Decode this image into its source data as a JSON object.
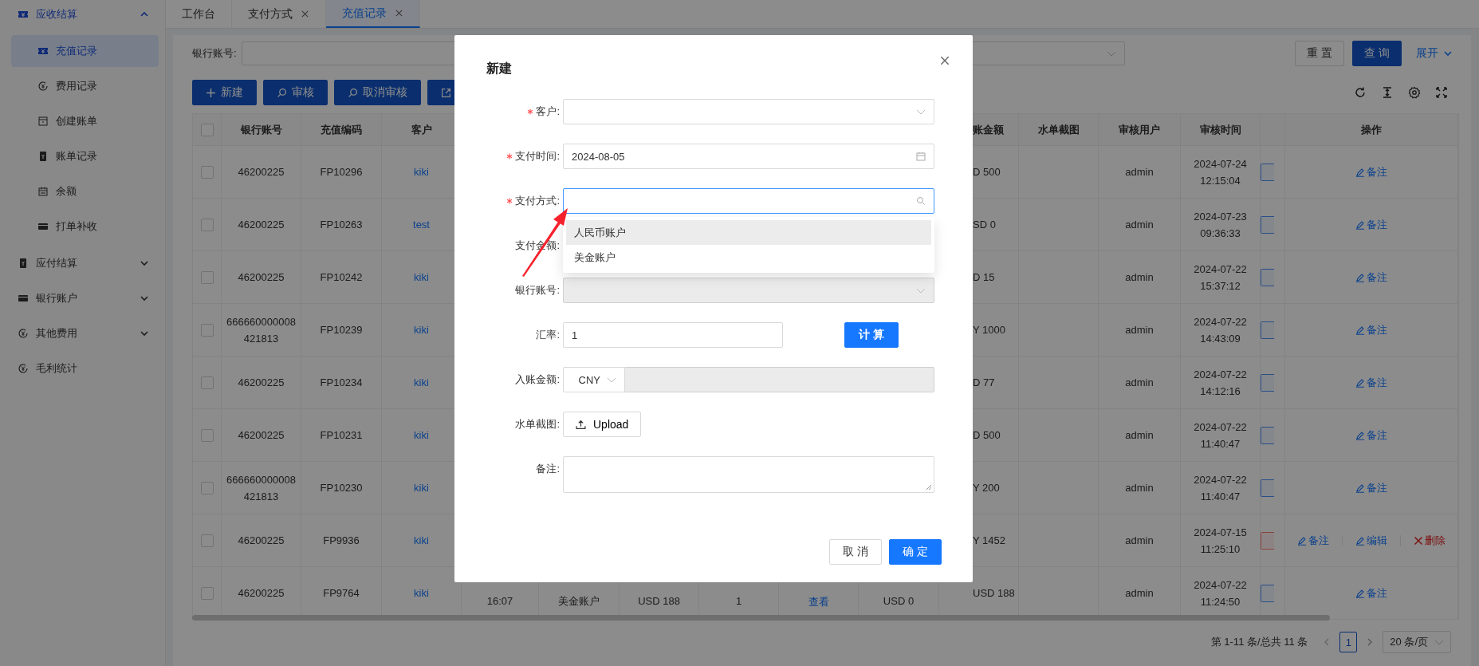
{
  "sidebar": {
    "items": [
      {
        "kind": "group",
        "label": "应收结算",
        "expanded": true,
        "children": [
          {
            "label": "充值记录",
            "selected": true
          },
          {
            "label": "费用记录",
            "selected": false
          },
          {
            "label": "创建账单",
            "selected": false
          },
          {
            "label": "账单记录",
            "selected": false
          },
          {
            "label": "余额",
            "selected": false
          },
          {
            "label": "打单补收",
            "selected": false
          }
        ]
      },
      {
        "kind": "group",
        "label": "应付结算",
        "expanded": false
      },
      {
        "kind": "group",
        "label": "银行账户",
        "expanded": false
      },
      {
        "kind": "group",
        "label": "其他费用",
        "expanded": false
      },
      {
        "kind": "item",
        "label": "毛利统计"
      }
    ]
  },
  "tabs": [
    {
      "label": "工作台",
      "closable": false,
      "selected": false
    },
    {
      "label": "支付方式",
      "closable": true,
      "selected": false
    },
    {
      "label": "充值记录",
      "closable": true,
      "selected": true
    }
  ],
  "search": {
    "label": "银行账号:",
    "buttons": [
      {
        "label": "重 置",
        "kind": "default"
      },
      {
        "label": "查 询",
        "kind": "primary"
      },
      {
        "label": "展开",
        "kind": "link"
      }
    ]
  },
  "toolbar": [
    {
      "label": "新建",
      "kind": "add"
    },
    {
      "label": "审核",
      "kind": "audit"
    },
    {
      "label": "取消审核",
      "kind": "audit"
    },
    {
      "kind": "export"
    }
  ],
  "table": {
    "select_all_checked": false,
    "columns": [
      "银行账号",
      "充值编码",
      "客户",
      "账金额",
      "水单截图",
      "审核用户",
      "审核时间",
      "操作"
    ],
    "rows": [
      {
        "checked": false,
        "bank_account": "46200225",
        "code": "FP10296",
        "customer": "kiki",
        "amount": "D 500",
        "auditor": "admin",
        "audit_time": "2024-07-24 12:15:04",
        "alert": false,
        "actions": [
          {
            "label": "备注",
            "kind": "note"
          }
        ]
      },
      {
        "checked": false,
        "bank_account": "46200225",
        "code": "FP10263",
        "customer": "test",
        "amount": "SD 0",
        "auditor": "admin",
        "audit_time": "2024-07-23 09:36:33",
        "alert": false,
        "actions": [
          {
            "label": "备注",
            "kind": "note"
          }
        ]
      },
      {
        "checked": false,
        "bank_account": "46200225",
        "code": "FP10242",
        "customer": "kiki",
        "amount": "D 15",
        "auditor": "admin",
        "audit_time": "2024-07-22 15:37:12",
        "alert": false,
        "actions": [
          {
            "label": "备注",
            "kind": "note"
          }
        ]
      },
      {
        "checked": false,
        "bank_account": "666660000008421813",
        "code": "FP10239",
        "customer": "kiki",
        "amount": "Y 1000",
        "auditor": "admin",
        "audit_time": "2024-07-22 14:43:09",
        "alert": false,
        "actions": [
          {
            "label": "备注",
            "kind": "note"
          }
        ]
      },
      {
        "checked": false,
        "bank_account": "46200225",
        "code": "FP10234",
        "customer": "kiki",
        "amount": "D 77",
        "auditor": "admin",
        "audit_time": "2024-07-22 14:12:16",
        "alert": false,
        "actions": [
          {
            "label": "备注",
            "kind": "note"
          }
        ]
      },
      {
        "checked": false,
        "bank_account": "46200225",
        "code": "FP10231",
        "customer": "kiki",
        "amount": "D 500",
        "auditor": "admin",
        "audit_time": "2024-07-22 11:40:47",
        "alert": false,
        "actions": [
          {
            "label": "备注",
            "kind": "note"
          }
        ]
      },
      {
        "checked": false,
        "bank_account": "666660000008421813",
        "code": "FP10230",
        "customer": "kiki",
        "amount": "Y 200",
        "auditor": "admin",
        "audit_time": "2024-07-22 11:40:47",
        "alert": false,
        "actions": [
          {
            "label": "备注",
            "kind": "note"
          }
        ]
      },
      {
        "checked": false,
        "bank_account": "46200225",
        "code": "FP9936",
        "customer": "kiki",
        "amount": "Y 1452",
        "auditor": "admin",
        "audit_time": "2024-07-15 11:25:10",
        "alert": true,
        "actions": [
          {
            "label": "备注",
            "kind": "note"
          },
          {
            "label": "编辑",
            "kind": "edit"
          },
          {
            "label": "删除",
            "kind": "delete"
          }
        ]
      },
      {
        "checked": false,
        "bank_account": "46200225",
        "code": "FP9764",
        "customer": "kiki",
        "middle": [
          {
            "text": "16:07",
            "kind": "text"
          },
          {
            "text": "美金账户",
            "kind": "text"
          },
          {
            "text": "USD 188",
            "kind": "text"
          },
          {
            "text": "1",
            "kind": "text"
          },
          {
            "text": "查看",
            "kind": "link"
          },
          {
            "text": "USD 0",
            "kind": "text"
          }
        ],
        "amount": "USD 188",
        "auditor": "admin",
        "audit_time": "2024-07-22 11:24:50",
        "alert": false,
        "actions": [
          {
            "label": "备注",
            "kind": "note"
          }
        ]
      }
    ]
  },
  "pagination": {
    "summary": "第 1-11 条/总共 11 条",
    "pages": [
      {
        "label": "1",
        "selected": true
      }
    ],
    "page_size": "20 条/页"
  },
  "modal": {
    "title": "新建",
    "fields": [
      {
        "kind": "select",
        "label": "客户:",
        "required": true,
        "disabled": false
      },
      {
        "kind": "date",
        "label": "支付时间:",
        "required": true,
        "value": "2024-08-05"
      },
      {
        "kind": "search_select",
        "label": "支付方式:",
        "required": true,
        "focused": true,
        "options": [
          {
            "label": "人民币账户",
            "selected": true
          },
          {
            "label": "美金账户",
            "selected": false
          }
        ]
      },
      {
        "kind": "covered",
        "label": "支付金额:",
        "required": false
      },
      {
        "kind": "select",
        "label": "银行账号:",
        "required": false,
        "disabled": true
      },
      {
        "kind": "input_button",
        "label": "汇率:",
        "required": false,
        "value": "1",
        "button": "计 算"
      },
      {
        "kind": "currency",
        "label": "入账金额:",
        "required": false,
        "currency": "CNY"
      },
      {
        "kind": "upload",
        "label": "水单截图:",
        "required": false,
        "button": "Upload"
      },
      {
        "kind": "textarea",
        "label": "备注:",
        "required": false
      }
    ],
    "buttons": [
      {
        "label": "取 消",
        "kind": "default"
      },
      {
        "label": "确 定",
        "kind": "primary"
      }
    ]
  }
}
